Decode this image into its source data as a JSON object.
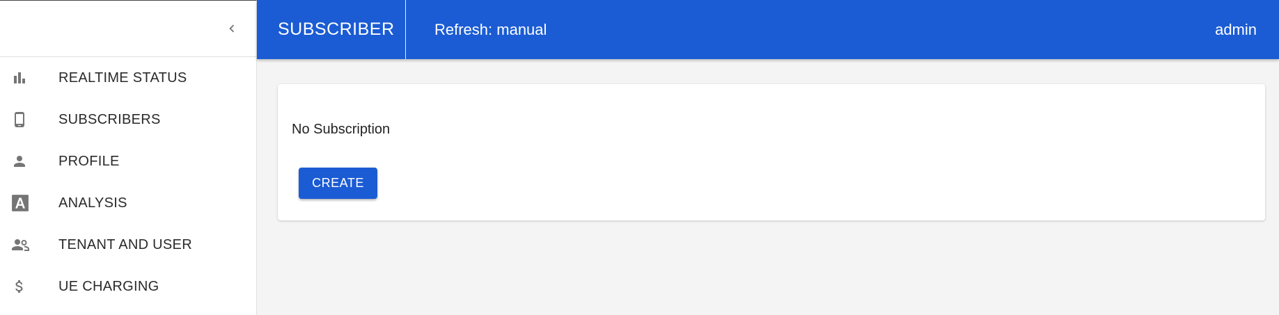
{
  "sidebar": {
    "collapse_icon": "chevron-left-icon",
    "items": [
      {
        "label": "REALTIME STATUS",
        "icon": "bar-chart-icon"
      },
      {
        "label": "SUBSCRIBERS",
        "icon": "smartphone-icon"
      },
      {
        "label": "PROFILE",
        "icon": "person-icon"
      },
      {
        "label": "ANALYSIS",
        "icon": "letter-a-icon"
      },
      {
        "label": "TENANT AND USER",
        "icon": "people-icon"
      },
      {
        "label": "UE CHARGING",
        "icon": "dollar-icon"
      }
    ]
  },
  "header": {
    "title": "SUBSCRIBER",
    "refresh": "Refresh: manual",
    "user": "admin"
  },
  "main": {
    "empty_message": "No Subscription",
    "create_label": "CREATE"
  },
  "colors": {
    "accent": "#1b5cd4",
    "background": "#f4f4f4",
    "icon": "#757575"
  }
}
